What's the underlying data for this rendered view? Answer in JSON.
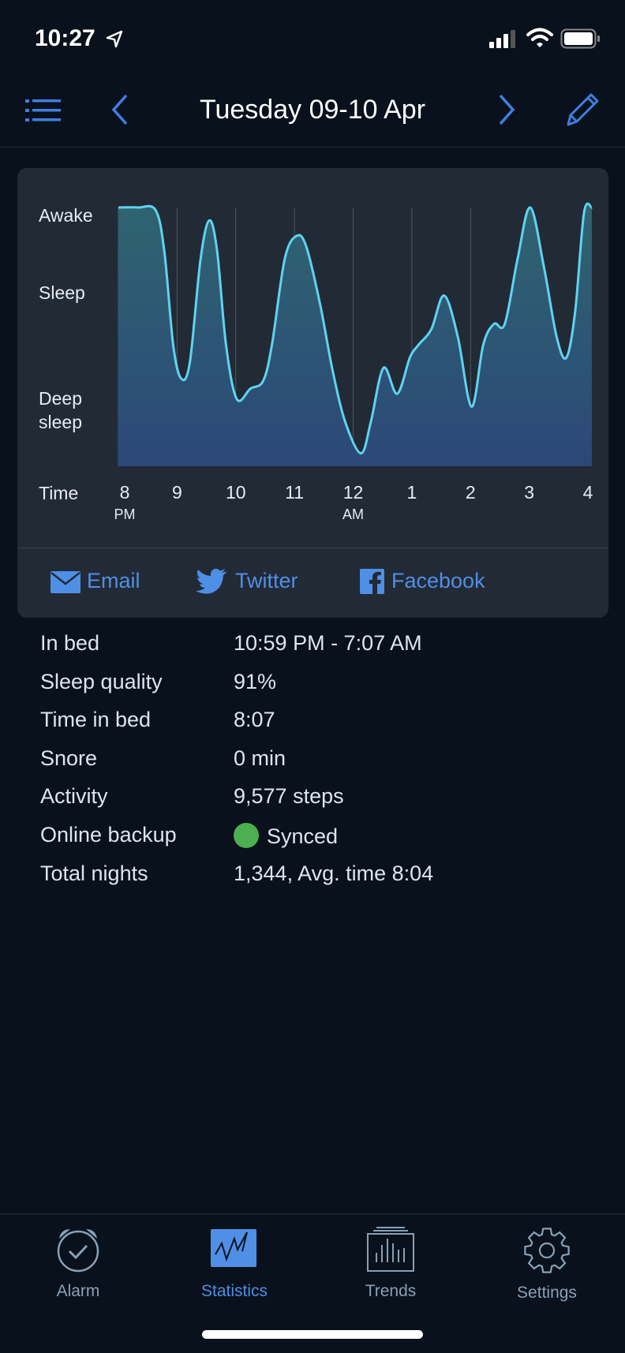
{
  "status_bar": {
    "time": "10:27",
    "icons": [
      "location-arrow-icon",
      "signal-icon",
      "wifi-icon",
      "battery-icon"
    ]
  },
  "header": {
    "title": "Tuesday 09-10 Apr",
    "icons": [
      "list-icon",
      "chevron-left-icon",
      "chevron-right-icon",
      "pencil-icon"
    ]
  },
  "colors": {
    "accent": "#4f8fe6",
    "line": "#5fd3f0",
    "background": "#08111c",
    "card": "#222a35",
    "synced": "#4caf50"
  },
  "chart_data": {
    "type": "area",
    "y_levels": [
      {
        "label": "Awake",
        "value": 97
      },
      {
        "label": "Sleep",
        "value": 67
      },
      {
        "label": "Deep\nsleep",
        "value": 20
      }
    ],
    "ylim": [
      0,
      100
    ],
    "xlabel": "Time",
    "x_ticks": [
      {
        "time": "20:00",
        "label": "8",
        "sub": "PM"
      },
      {
        "time": "21:00",
        "label": "9"
      },
      {
        "time": "22:00",
        "label": "10"
      },
      {
        "time": "23:00",
        "label": "11"
      },
      {
        "time": "00:00",
        "label": "12",
        "sub": "AM"
      },
      {
        "time": "01:00",
        "label": "1"
      },
      {
        "time": "02:00",
        "label": "2"
      },
      {
        "time": "03:00",
        "label": "3"
      },
      {
        "time": "04:00",
        "label": "4"
      }
    ],
    "xlim": [
      "20:00",
      "04:04"
    ],
    "grid": true,
    "points": [
      [
        "20:00",
        100
      ],
      [
        "20:20",
        100
      ],
      [
        "20:38",
        99
      ],
      [
        "20:47",
        83
      ],
      [
        "20:56",
        47
      ],
      [
        "21:04",
        34
      ],
      [
        "21:13",
        40
      ],
      [
        "21:24",
        80
      ],
      [
        "21:33",
        95
      ],
      [
        "21:41",
        83
      ],
      [
        "21:50",
        47
      ],
      [
        "22:01",
        26
      ],
      [
        "22:15",
        30
      ],
      [
        "22:28",
        33
      ],
      [
        "22:37",
        47
      ],
      [
        "22:50",
        80
      ],
      [
        "23:02",
        89
      ],
      [
        "23:12",
        85
      ],
      [
        "23:26",
        63
      ],
      [
        "23:39",
        37
      ],
      [
        "23:52",
        17
      ],
      [
        "00:08",
        5
      ],
      [
        "00:18",
        17
      ],
      [
        "00:31",
        38
      ],
      [
        "00:45",
        28
      ],
      [
        "00:58",
        42
      ],
      [
        "01:07",
        47
      ],
      [
        "01:20",
        53
      ],
      [
        "01:33",
        66
      ],
      [
        "01:47",
        50
      ],
      [
        "02:01",
        23
      ],
      [
        "02:13",
        47
      ],
      [
        "02:24",
        55
      ],
      [
        "02:35",
        55
      ],
      [
        "02:48",
        80
      ],
      [
        "03:01",
        100
      ],
      [
        "03:15",
        77
      ],
      [
        "03:28",
        50
      ],
      [
        "03:38",
        42
      ],
      [
        "03:47",
        60
      ],
      [
        "03:56",
        98
      ],
      [
        "04:04",
        100
      ]
    ]
  },
  "share": {
    "email": "Email",
    "twitter": "Twitter",
    "facebook": "Facebook"
  },
  "stats": [
    {
      "label": "In bed",
      "value": "10:59 PM - 7:07 AM"
    },
    {
      "label": "Sleep quality",
      "value": "91%"
    },
    {
      "label": "Time in bed",
      "value": "8:07"
    },
    {
      "label": "Snore",
      "value": "0 min"
    },
    {
      "label": "Activity",
      "value": "9,577 steps"
    },
    {
      "label": "Online backup",
      "value": "Synced"
    },
    {
      "label": "Total nights",
      "value": "1,344, Avg. time 8:04"
    }
  ],
  "tabs": [
    {
      "label": "Alarm",
      "icon": "alarm-clock-icon"
    },
    {
      "label": "Statistics",
      "icon": "statistics-icon",
      "active": true
    },
    {
      "label": "Trends",
      "icon": "trends-icon"
    },
    {
      "label": "Settings",
      "icon": "gear-icon"
    }
  ]
}
